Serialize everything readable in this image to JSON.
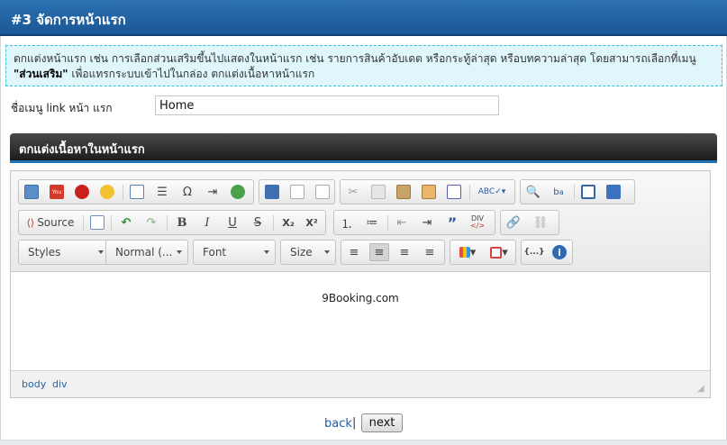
{
  "header": {
    "title": "#3 จัดการหน้าแรก"
  },
  "info": {
    "line1": "ตกแต่งหน้าแรก เช่น การเลือกส่วนเสริมขึ้นไปแสดงในหน้าแรก เช่น รายการสินค้าอับเดต หรือกระทู้ล่าสุด หรือบทความล่าสุด โดยสามารถเลือกที่เมนู",
    "bold": "\"ส่วนเสริม\"",
    "line2": " เพื่อแทรกระบบเข้าไปในกล่อง ตกแต่งเนื้อหาหน้าแรก"
  },
  "menu": {
    "label": "ชื่อเมนู link หน้า แรก",
    "value": "Home"
  },
  "section": {
    "title": "ตกแต่งเนื้อหาในหน้าแรก"
  },
  "editor": {
    "source_label": "Source",
    "bold": "B",
    "italic": "I",
    "underline": "U",
    "strike": "S",
    "subscript": "X₂",
    "superscript": "X²",
    "styles": "Styles",
    "format": "Normal (...",
    "font": "Font",
    "size": "Size",
    "div": "DIV",
    "content": "9Booking.com",
    "path": [
      "body",
      "div"
    ]
  },
  "footer": {
    "back": "back",
    "pipe": "|",
    "next": "next"
  },
  "colors": {
    "title_bar": "#1a5796",
    "info_bg": "#dff7fb",
    "info_border": "#35c0d4",
    "section_bar": "#2a2a2a",
    "accent": "#1c73b8"
  }
}
